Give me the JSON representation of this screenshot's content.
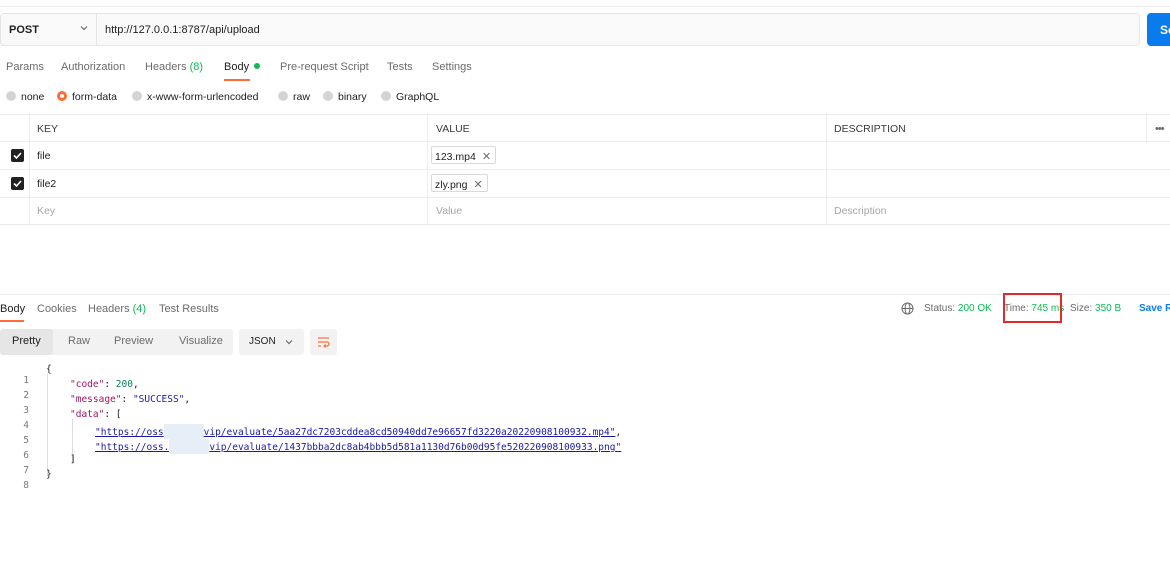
{
  "request": {
    "method": "POST",
    "url": "http://127.0.0.1:8787/api/upload",
    "send_label": "Se"
  },
  "request_tabs": [
    {
      "label": "Params"
    },
    {
      "label": "Authorization"
    },
    {
      "label": "Headers",
      "count": "(8)"
    },
    {
      "label": "Body"
    },
    {
      "label": "Pre-request Script"
    },
    {
      "label": "Tests"
    },
    {
      "label": "Settings"
    }
  ],
  "body_types": [
    {
      "label": "none",
      "checked": false
    },
    {
      "label": "form-data",
      "checked": true
    },
    {
      "label": "x-www-form-urlencoded",
      "checked": false
    },
    {
      "label": "raw",
      "checked": false
    },
    {
      "label": "binary",
      "checked": false
    },
    {
      "label": "GraphQL",
      "checked": false
    }
  ],
  "table": {
    "headers": {
      "key": "KEY",
      "value": "VALUE",
      "description": "DESCRIPTION"
    },
    "rows": [
      {
        "key": "file",
        "value": "123.mp4",
        "checked": true
      },
      {
        "key": "file2",
        "value": "zly.png",
        "checked": true
      }
    ],
    "placeholders": {
      "key": "Key",
      "value": "Value",
      "description": "Description"
    },
    "more": "•••",
    "chip_remove": "✕"
  },
  "response_tabs": [
    {
      "label": "Body"
    },
    {
      "label": "Cookies"
    },
    {
      "label": "Headers",
      "count": "(4)"
    },
    {
      "label": "Test Results"
    }
  ],
  "status": {
    "status_label": "Status:",
    "status_value": "200 OK",
    "time_label": "Time:",
    "time_value": "745 ms",
    "size_label": "Size:",
    "size_value": "350 B",
    "save_label": "Save R"
  },
  "view_modes": [
    "Pretty",
    "Raw",
    "Preview",
    "Visualize"
  ],
  "format": "JSON",
  "code_lines": {
    "l1": "{",
    "l2_key": "\"code\"",
    "l2_val": "200",
    "l3_key": "\"message\"",
    "l3_val": "\"SUCCESS\"",
    "l4_key": "\"data\"",
    "l4_open": "[",
    "l5_a": "\"https://oss",
    "l5_b": "vip/evaluate/5aa27dc7203cddea8cd50940dd7e96657fd3220a20220908100932.mp4\"",
    "l6_a": "\"https://oss.",
    "l6_b": "vip/evaluate/1437bbba2dc8ab4bbb5d581a1130d76b00d95fe520220908100933.png\"",
    "l7": "]",
    "l8": "}"
  },
  "colors": {
    "accent_orange": "#ff6c37",
    "success_green": "#0cbb52",
    "brand_blue": "#097bed",
    "highlight_red": "#e32a2a"
  }
}
